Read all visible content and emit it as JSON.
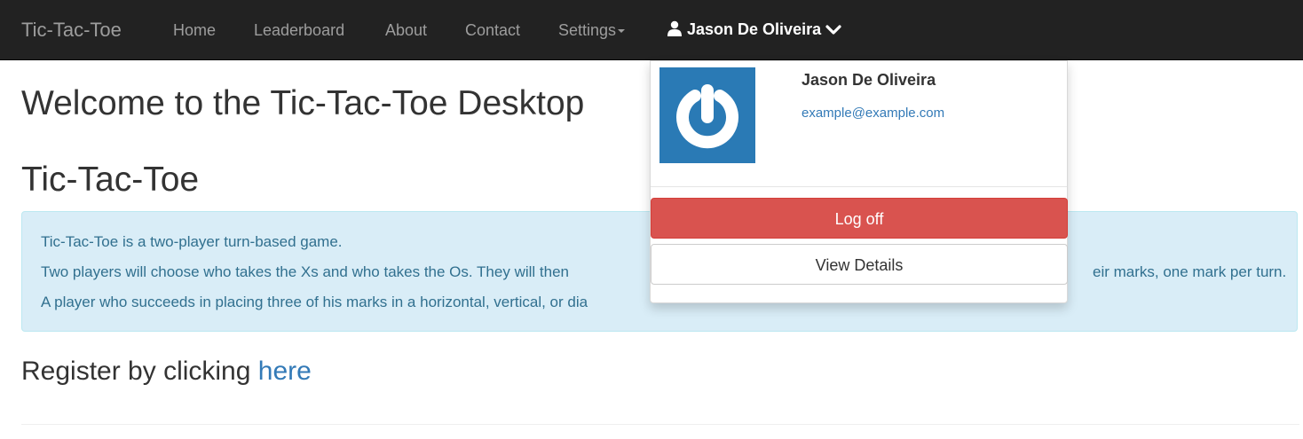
{
  "navbar": {
    "brand": "Tic-Tac-Toe",
    "links": [
      "Home",
      "Leaderboard",
      "About",
      "Contact"
    ],
    "settings_label": "Settings",
    "user_name": "Jason De Oliveira"
  },
  "main": {
    "welcome_heading": "Welcome to the Tic-Tac-Toe Desktop",
    "game_heading": "Tic-Tac-Toe",
    "info_lines": [
      "Tic-Tac-Toe is a two-player turn-based game.",
      "Two players will choose who takes the Xs and who takes the Os. They will then",
      "eir marks, one mark per turn.",
      "A player who succeeds in placing three of his marks in a horizontal, vertical, or dia"
    ],
    "register_text": "Register by clicking ",
    "register_link": "here"
  },
  "dropdown": {
    "name": "Jason De Oliveira",
    "email": "example@example.com",
    "logoff_label": "Log off",
    "view_details_label": "View Details",
    "avatar_icon": "power-icon"
  },
  "colors": {
    "navbar_bg": "#222222",
    "info_bg": "#d9edf7",
    "info_text": "#31708f",
    "danger": "#d9534f",
    "link": "#337ab7",
    "avatar_bg": "#2a7ab5"
  }
}
